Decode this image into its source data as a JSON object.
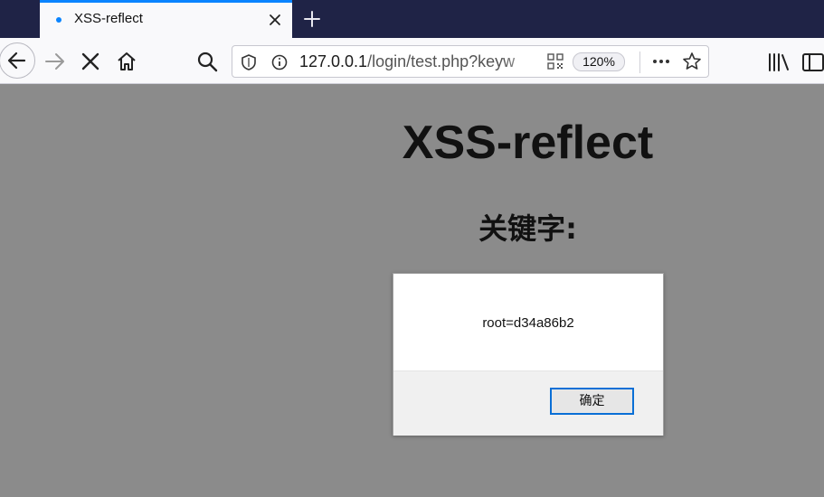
{
  "browser": {
    "tab": {
      "title": "XSS-reflect"
    },
    "url": {
      "host": "127.0.0.1",
      "path": "/login/test.php?keyw"
    },
    "zoom": "120%"
  },
  "page": {
    "title": "XSS-reflect",
    "subtitle": "关键字:"
  },
  "dialog": {
    "message": "root=d34a86b2",
    "ok_label": "确定"
  },
  "colors": {
    "tabstrip": "#1f2346",
    "accent": "#0a84ff",
    "page_bg": "#8b8b8b"
  }
}
